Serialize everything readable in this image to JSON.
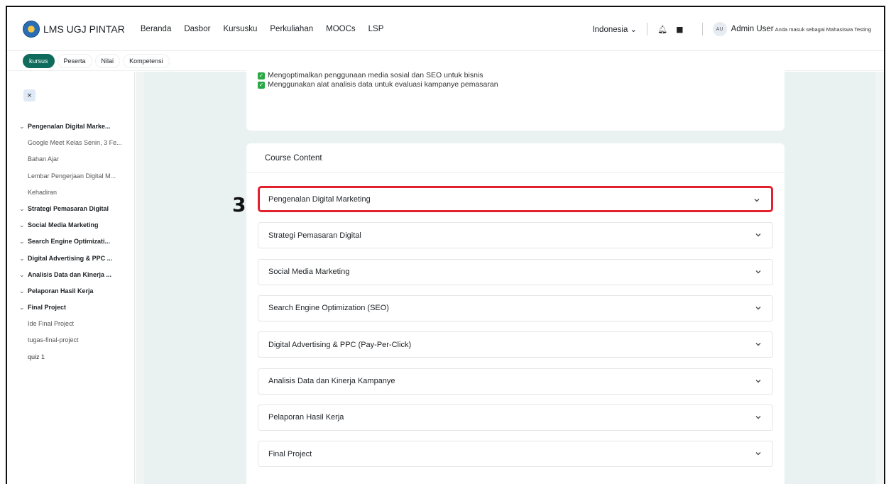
{
  "app": {
    "brand": "LMS UGJ PINTAR"
  },
  "navbar": {
    "links": [
      "Beranda",
      "Dasbor",
      "Kursusku",
      "Perkuliahan",
      "MOOCs",
      "LSP"
    ],
    "language": "Indonesia ⌄",
    "avatar_initials": "AU",
    "user_name": "Admin User",
    "user_role_note": "Anda masuk sebagai Mahasiswa Testing"
  },
  "subnav": {
    "tabs": [
      "kursus",
      "Peserta",
      "Nilai",
      "Kompetensi"
    ],
    "active": "kursus"
  },
  "sidebar": {
    "close_label": "×",
    "items": [
      {
        "type": "section",
        "label": "Pengenalan Digital Marke..."
      },
      {
        "type": "activity",
        "label": "Google Meet Kelas Senin, 3 Fe..."
      },
      {
        "type": "activity",
        "label": "Bahan Ajar"
      },
      {
        "type": "activity",
        "label": "Lembar Pengerjaan Digital M..."
      },
      {
        "type": "activity",
        "label": "Kehadiran"
      },
      {
        "type": "section",
        "label": "Strategi Pemasaran Digital"
      },
      {
        "type": "section",
        "label": "Social Media Marketing"
      },
      {
        "type": "section",
        "label": "Search Engine Optimizati..."
      },
      {
        "type": "section",
        "label": "Digital Advertising & PPC ..."
      },
      {
        "type": "section",
        "label": "Analisis Data dan Kinerja ..."
      },
      {
        "type": "section",
        "label": "Pelaporan Hasil Kerja"
      },
      {
        "type": "section",
        "label": "Final Project"
      },
      {
        "type": "activity",
        "label": "Ide Final Project"
      },
      {
        "type": "activity",
        "label": "tugas-final-project"
      },
      {
        "type": "activity-dark",
        "label": "quiz 1"
      }
    ]
  },
  "objectives": [
    "Mengoptimalkan penggunaan media sosial dan SEO untuk bisnis",
    "Menggunakan alat analisis data untuk evaluasi kampanye pemasaran"
  ],
  "course_content": {
    "title": "Course Content",
    "sections": [
      "Pengenalan Digital Marketing",
      "Strategi Pemasaran Digital",
      "Social Media Marketing",
      "Search Engine Optimization (SEO)",
      "Digital Advertising & PPC (Pay-Per-Click)",
      "Analisis Data dan Kinerja Kampanye",
      "Pelaporan Hasil Kerja",
      "Final Project"
    ],
    "highlighted_index": 0
  },
  "annotation": {
    "step_number": "3",
    "color": "#e2212f"
  },
  "colors": {
    "accent": "#0f6c5c",
    "highlight": "#e2212f",
    "check": "#2aa845"
  }
}
